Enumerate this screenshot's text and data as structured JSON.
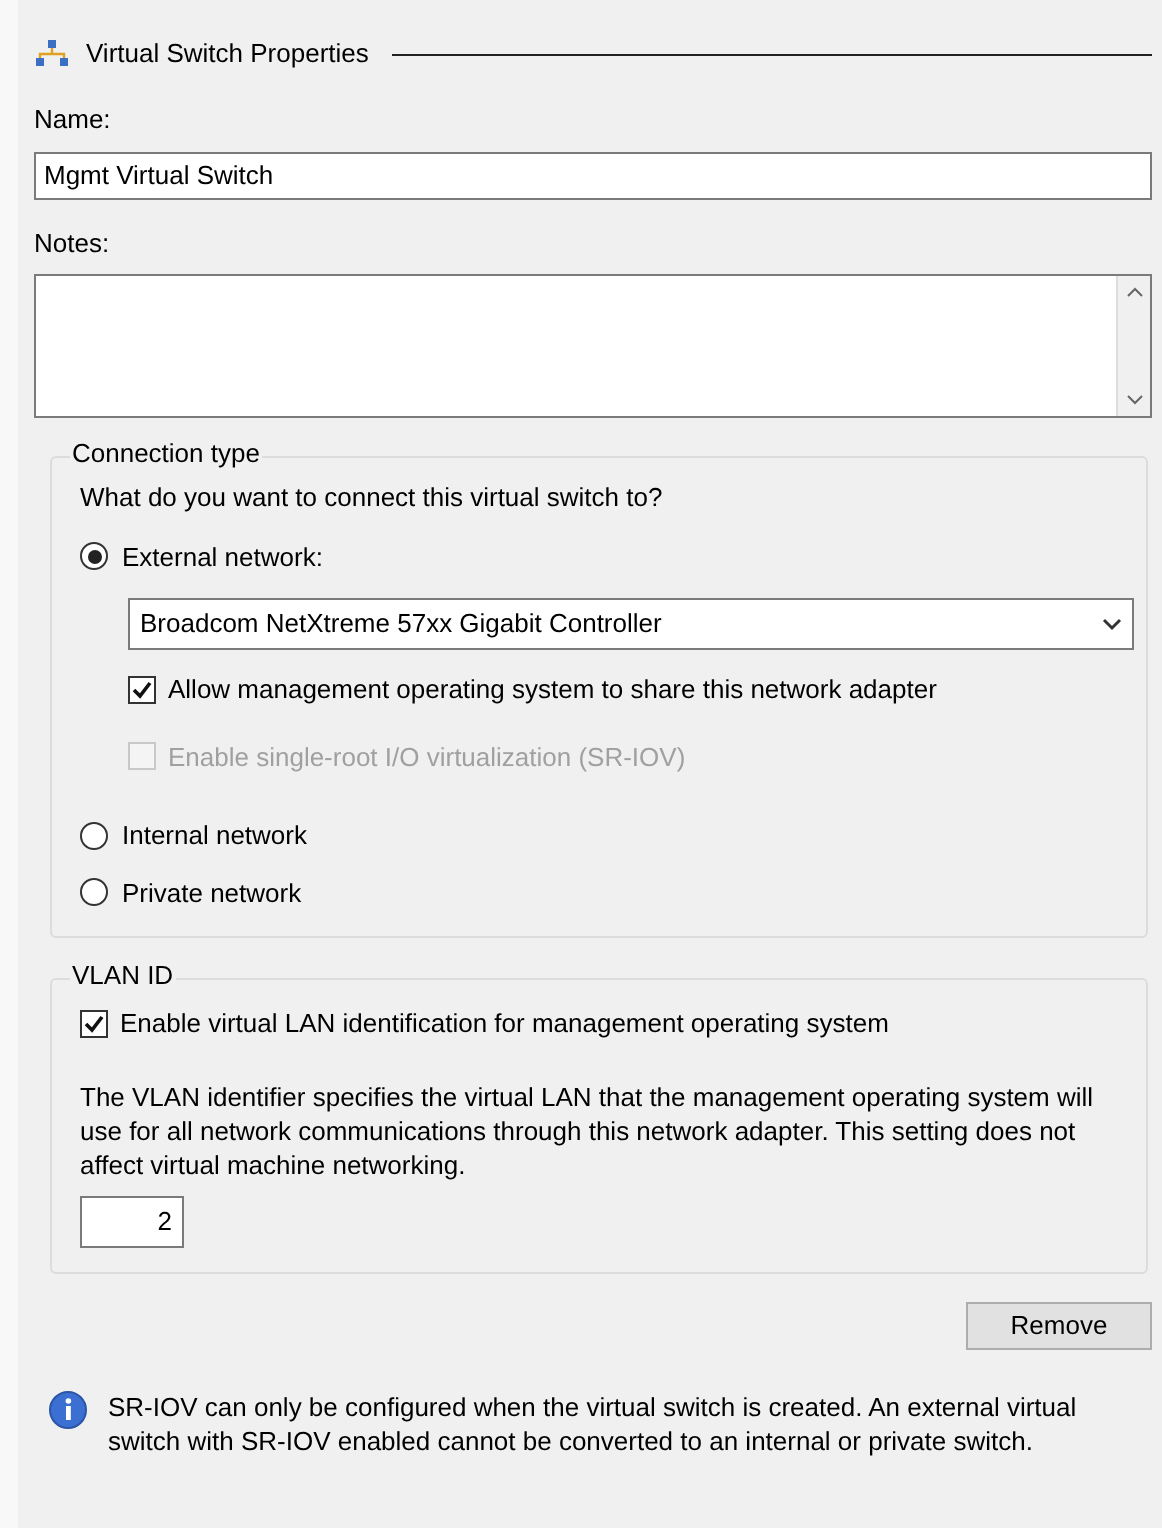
{
  "header": {
    "title": "Virtual Switch Properties"
  },
  "name": {
    "label": "Name:",
    "value": "Mgmt Virtual Switch"
  },
  "notes": {
    "label": "Notes:"
  },
  "connection": {
    "title": "Connection type",
    "question": "What do you want to connect this virtual switch to?",
    "options": [
      {
        "label": "External network:",
        "selected": true
      },
      {
        "label": "Internal network",
        "selected": false
      },
      {
        "label": "Private network",
        "selected": false
      }
    ],
    "adapter": {
      "value": "Broadcom NetXtreme 57xx Gigabit Controller"
    },
    "checkboxes": [
      {
        "label": "Allow management operating system to share this network adapter",
        "checked": true,
        "disabled": false
      },
      {
        "label": "Enable single-root I/O virtualization (SR-IOV)",
        "checked": false,
        "disabled": true
      }
    ]
  },
  "vlan": {
    "title": "VLAN ID",
    "checkbox": {
      "label": "Enable virtual LAN identification for management operating system",
      "checked": true
    },
    "description": "The VLAN identifier specifies the virtual LAN that the management operating system will use for all network communications through this network adapter. This setting does not affect virtual machine networking.",
    "value": "2"
  },
  "remove_button": "Remove",
  "info": "SR-IOV can only be configured when the virtual switch is created. An external virtual switch with SR-IOV enabled cannot be converted to an internal or private switch."
}
